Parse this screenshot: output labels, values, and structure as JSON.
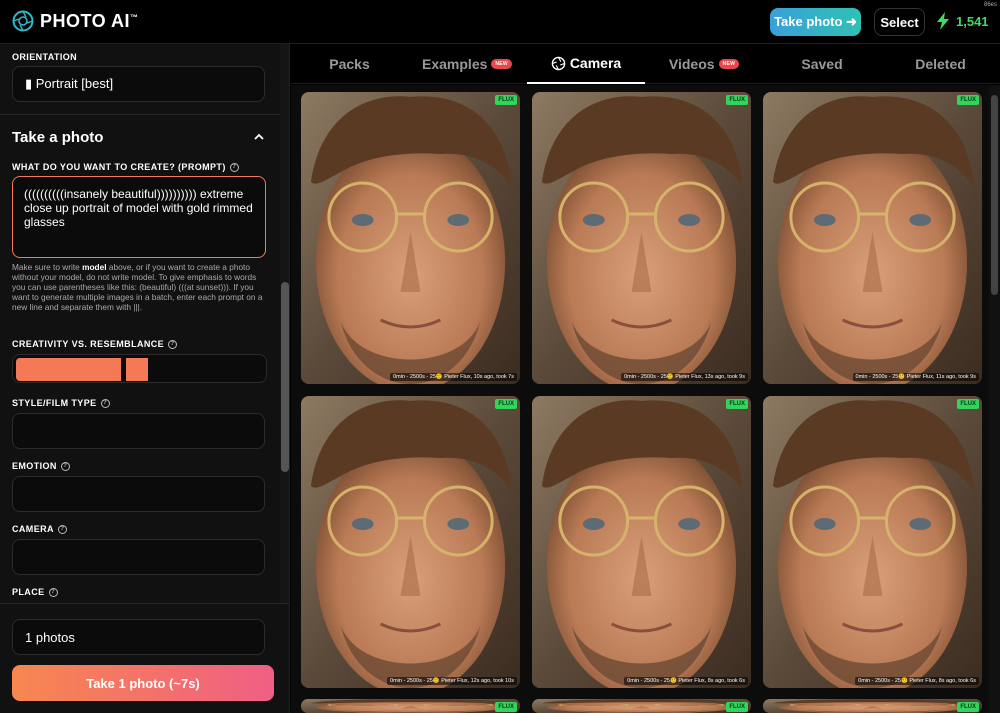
{
  "header": {
    "logo_text": "PHOTO AI",
    "logo_tm": "™",
    "take_photo_label": "Take photo ➜",
    "select_label": "Select",
    "credits": "1,541",
    "size_label": "86es"
  },
  "sidebar": {
    "orientation_label": "ORIENTATION",
    "orientation_value": "▮ Portrait [best]",
    "take_photo_heading": "Take a photo",
    "prompt_label": "WHAT DO YOU WANT TO CREATE? (PROMPT)",
    "prompt_value": "((((((((((insanely beautiful)))))))))) extreme close up portrait of model with gold rimmed glasses",
    "help_prefix": "Make sure to write ",
    "help_bold": "model",
    "help_suffix": " above, or if you want to create a photo without your model, do not write model. To give emphasis to words you can use parentheses like this: (beautiful) (((at sunset))). If you want to generate multiple images in a batch, enter each prompt on a new line and separate them with |||.",
    "creativity_label": "CREATIVITY VS. RESEMBLANCE",
    "creativity_level": 0.62,
    "style_label": "STYLE/FILM TYPE",
    "emotion_label": "EMOTION",
    "camera_label": "CAMERA",
    "place_label": "PLACE",
    "photos_count": "1 photos",
    "cta_label": "Take 1 photo (~7s)"
  },
  "tabs": [
    {
      "label": "Packs",
      "badge": ""
    },
    {
      "label": "Examples",
      "badge": "NEW"
    },
    {
      "label": "Camera",
      "badge": ""
    },
    {
      "label": "Videos",
      "badge": "NEW"
    },
    {
      "label": "Saved",
      "badge": ""
    },
    {
      "label": "Deleted",
      "badge": ""
    }
  ],
  "active_tab": "Camera",
  "photos": [
    {
      "badge": "FLUX",
      "caption": "0min - 2500s - 25🤨 Pieter Flux, 10s ago, took 7s"
    },
    {
      "badge": "FLUX",
      "caption": "0min - 2500s - 25🤨 Pieter Flux, 13s ago, took 9s"
    },
    {
      "badge": "FLUX",
      "caption": "0min - 2500s - 25🤨 Pieter Flux, 11s ago, took 9s"
    },
    {
      "badge": "FLUX",
      "caption": "0min - 2500s - 25🤨 Pieter Flux, 12s ago, took 10s"
    },
    {
      "badge": "FLUX",
      "caption": "0min - 2500s - 25🤨 Pieter Flux, 8s ago, took 6s"
    },
    {
      "badge": "FLUX",
      "caption": "0min - 2500s - 25🤨 Pieter Flux, 8s ago, took 6s"
    },
    {
      "badge": "FLUX",
      "caption": ""
    },
    {
      "badge": "FLUX",
      "caption": ""
    },
    {
      "badge": "FLUX",
      "caption": ""
    }
  ],
  "colors": {
    "accent": "#f47a57",
    "credits_green": "#3ddc63",
    "flux_badge": "#33d45b",
    "new_badge": "#e6484c"
  }
}
